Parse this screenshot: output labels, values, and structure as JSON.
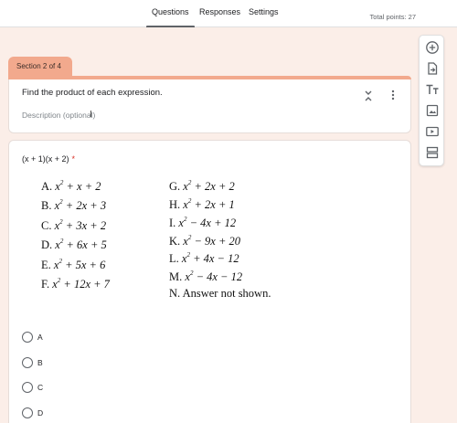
{
  "tabs": [
    {
      "label": "Questions",
      "active": true
    },
    {
      "label": "Responses",
      "active": false
    },
    {
      "label": "Settings",
      "active": false
    }
  ],
  "total_points": "Total points: 27",
  "section": {
    "tab_label": "Section 2 of 4",
    "title": "Find the product of each expression.",
    "description_placeholder": "Description (optional)"
  },
  "question": {
    "title": "(x + 1)(x + 2)",
    "required_mark": "*",
    "choices_image": {
      "left": [
        {
          "letter": "A.",
          "expr": "x² + x + 2"
        },
        {
          "letter": "B.",
          "expr": "x² + 2x + 3"
        },
        {
          "letter": "C.",
          "expr": "x² + 3x + 2"
        },
        {
          "letter": "D.",
          "expr": "x² + 6x + 5"
        },
        {
          "letter": "E.",
          "expr": "x² + 5x + 6"
        },
        {
          "letter": "F.",
          "expr": "x² + 12x + 7"
        }
      ],
      "right": [
        {
          "letter": "G.",
          "expr": "x² + 2x + 2"
        },
        {
          "letter": "H.",
          "expr": "x² + 2x + 1"
        },
        {
          "letter": "I.",
          "expr": "x² − 4x + 12"
        },
        {
          "letter": "K.",
          "expr": "x² − 9x + 20"
        },
        {
          "letter": "L.",
          "expr": "x² + 4x − 12"
        },
        {
          "letter": "M.",
          "expr": "x² − 4x − 12"
        },
        {
          "letter": "N.",
          "expr": "Answer not shown."
        }
      ]
    },
    "options": [
      "A",
      "B",
      "C",
      "D"
    ]
  },
  "toolbar_icons": [
    "add-question-icon",
    "import-questions-icon",
    "add-title-icon",
    "add-image-icon",
    "add-video-icon",
    "add-section-icon"
  ],
  "colors": {
    "accent": "#f2a98d",
    "background": "#fbeee8",
    "required": "#d93025"
  }
}
